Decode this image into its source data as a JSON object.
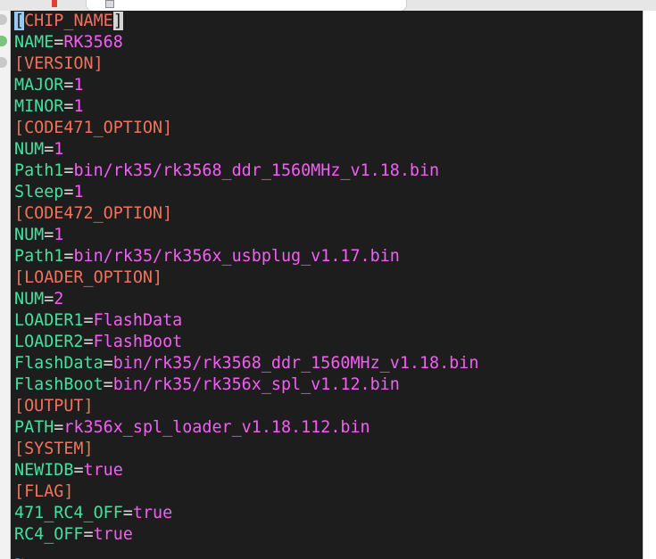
{
  "editor": {
    "lines": [
      {
        "type": "section",
        "text": "[CHIP_NAME]"
      },
      {
        "type": "kv",
        "key": "NAME",
        "value": "RK3568"
      },
      {
        "type": "section",
        "text": "[VERSION]"
      },
      {
        "type": "kv",
        "key": "MAJOR",
        "value": "1"
      },
      {
        "type": "kv",
        "key": "MINOR",
        "value": "1"
      },
      {
        "type": "section",
        "text": "[CODE471_OPTION]"
      },
      {
        "type": "kv",
        "key": "NUM",
        "value": "1"
      },
      {
        "type": "kv",
        "key": "Path1",
        "value": "bin/rk35/rk3568_ddr_1560MHz_v1.18.bin"
      },
      {
        "type": "kv",
        "key": "Sleep",
        "value": "1"
      },
      {
        "type": "section",
        "text": "[CODE472_OPTION]"
      },
      {
        "type": "kv",
        "key": "NUM",
        "value": "1"
      },
      {
        "type": "kv",
        "key": "Path1",
        "value": "bin/rk35/rk356x_usbplug_v1.17.bin"
      },
      {
        "type": "section",
        "text": "[LOADER_OPTION]"
      },
      {
        "type": "kv",
        "key": "NUM",
        "value": "2"
      },
      {
        "type": "kv",
        "key": "LOADER1",
        "value": "FlashData"
      },
      {
        "type": "kv",
        "key": "LOADER2",
        "value": "FlashBoot"
      },
      {
        "type": "kv",
        "key": "FlashData",
        "value": "bin/rk35/rk3568_ddr_1560MHz_v1.18.bin"
      },
      {
        "type": "kv",
        "key": "FlashBoot",
        "value": "bin/rk35/rk356x_spl_v1.12.bin"
      },
      {
        "type": "section",
        "text": "[OUTPUT]"
      },
      {
        "type": "kv",
        "key": "PATH",
        "value": "rk356x_spl_loader_v1.18.112.bin"
      },
      {
        "type": "section",
        "text": "[SYSTEM]"
      },
      {
        "type": "kv",
        "key": "NEWIDB",
        "value": "true"
      },
      {
        "type": "section",
        "text": "[FLAG]"
      },
      {
        "type": "kv",
        "key": "471_RC4_OFF",
        "value": "true"
      },
      {
        "type": "kv",
        "key": "RC4_OFF",
        "value": "true"
      }
    ],
    "end_marker": "~"
  },
  "colors": {
    "background": "#1d1d1d",
    "section": "#ef735e",
    "key": "#45e0a0",
    "equals": "#d7d7d7",
    "value": "#f45ef2",
    "cursor": "#9bc9f0",
    "tilde": "#2f8fd8"
  }
}
